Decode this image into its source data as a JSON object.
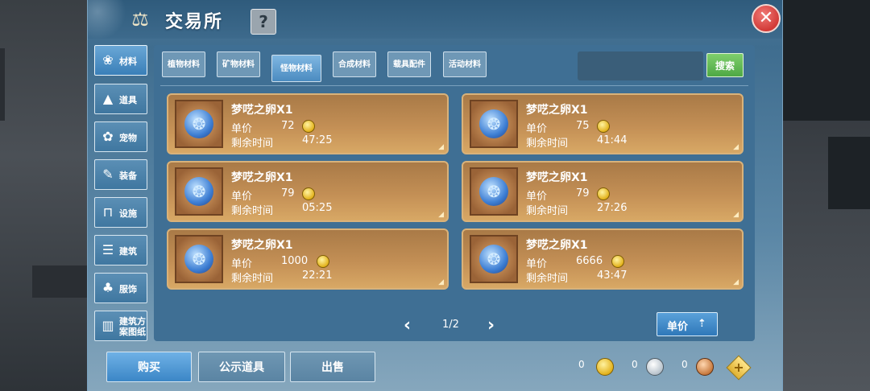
{
  "window": {
    "title": "交易所",
    "help_label": "?",
    "close_label": "✕"
  },
  "sidebar": {
    "items": [
      {
        "label": "材料",
        "icon": "materials-icon",
        "glyph": "❀"
      },
      {
        "label": "道具",
        "icon": "tool-icon",
        "glyph": "▲"
      },
      {
        "label": "宠物",
        "icon": "paw-icon",
        "glyph": "✿"
      },
      {
        "label": "装备",
        "icon": "equipment-icon",
        "glyph": "✎"
      },
      {
        "label": "设施",
        "icon": "facility-icon",
        "glyph": "⊓"
      },
      {
        "label": "建筑",
        "icon": "building-icon",
        "glyph": "☰"
      },
      {
        "label": "服饰",
        "icon": "clothing-icon",
        "glyph": "♣"
      },
      {
        "label": "建筑方案图纸",
        "icon": "blueprint-icon",
        "glyph": "▥"
      }
    ],
    "active_index": 0
  },
  "categories": {
    "tabs": [
      "植物材料",
      "矿物材料",
      "怪物材料",
      "合成材料",
      "载具配件",
      "活动材料"
    ],
    "active_index": 2
  },
  "search": {
    "placeholder": "",
    "button_label": "搜索"
  },
  "listings": [
    {
      "name": "梦呓之卵X1",
      "price_label": "单价",
      "price": "72",
      "time_label": "剩余时间",
      "time": "47:25"
    },
    {
      "name": "梦呓之卵X1",
      "price_label": "单价",
      "price": "75",
      "time_label": "剩余时间",
      "time": "41:44"
    },
    {
      "name": "梦呓之卵X1",
      "price_label": "单价",
      "price": "79",
      "time_label": "剩余时间",
      "time": "05:25"
    },
    {
      "name": "梦呓之卵X1",
      "price_label": "单价",
      "price": "79",
      "time_label": "剩余时间",
      "time": "27:26"
    },
    {
      "name": "梦呓之卵X1",
      "price_label": "单价",
      "price": "1000",
      "time_label": "剩余时间",
      "time": "22:21"
    },
    {
      "name": "梦呓之卵X1",
      "price_label": "单价",
      "price": "6666",
      "time_label": "剩余时间",
      "time": "43:47"
    }
  ],
  "pager": {
    "current": "1/2",
    "prev": "‹",
    "next": "›"
  },
  "sort": {
    "label": "单价",
    "arrow": "⇡"
  },
  "actions": {
    "buy": "购买",
    "publish": "公示道具",
    "sell": "出售"
  },
  "currencies": {
    "gold": "0",
    "silver": "0",
    "bronze": "0",
    "add_label": "+"
  },
  "colors": {
    "accent": "#3b86c6",
    "search_green": "#4ea845",
    "card_gold": "#c38f55",
    "close_red": "#d23a37"
  }
}
